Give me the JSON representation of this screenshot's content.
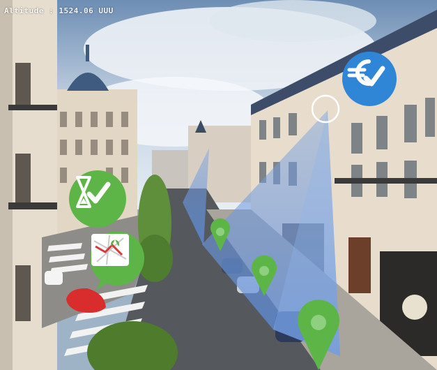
{
  "overlay": {
    "altitude_label": "Altitude : 1524.06 UUU"
  },
  "badges": [
    {
      "name": "time-check-badge",
      "icon": "hourglass-check-icon",
      "color": "#5db547"
    },
    {
      "name": "map-route-badge",
      "icon": "map-route-icon",
      "color": "#5db547"
    },
    {
      "name": "euro-check-badge",
      "icon": "euro-check-icon",
      "color": "#2f86d6"
    }
  ],
  "markers": [
    {
      "name": "location-pin",
      "icon": "map-pin-icon",
      "color": "#5db547"
    },
    {
      "name": "location-pin",
      "icon": "map-pin-icon",
      "color": "#5db547"
    },
    {
      "name": "location-pin",
      "icon": "map-pin-icon",
      "color": "#5db547"
    }
  ],
  "view_cone_color": "#6a97d9"
}
